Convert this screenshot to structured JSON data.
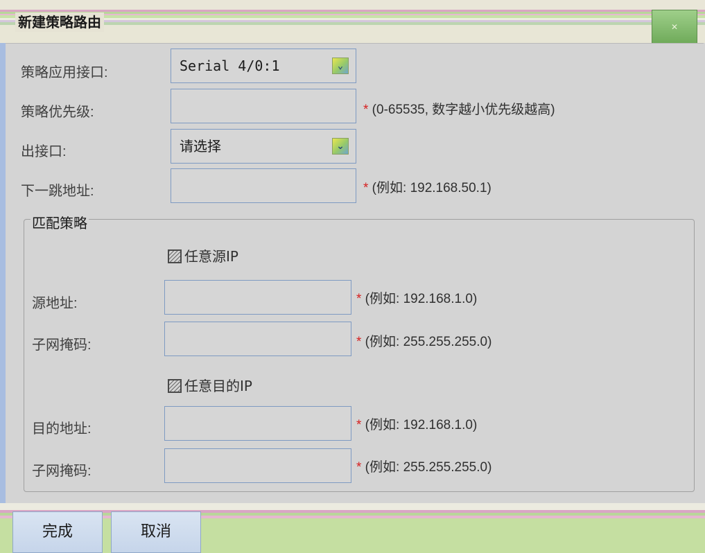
{
  "dialog": {
    "title": "新建策略路由",
    "close_label": "关闭"
  },
  "form": {
    "interface_label": "策略应用接口:",
    "interface_value": "Serial 4/0:1",
    "priority_label": "策略优先级:",
    "priority_value": "",
    "priority_hint_star": "*",
    "priority_hint": " (0-65535, 数字越小优先级越高)",
    "out_iface_label": "出接口:",
    "out_iface_value": "请选择",
    "nexthop_label": "下一跳地址:",
    "nexthop_value": "",
    "nexthop_hint_star": "*",
    "nexthop_hint": " (例如: 192.168.50.1)"
  },
  "match": {
    "legend": "匹配策略",
    "any_src_label": "任意源IP",
    "any_src_checked": true,
    "src_addr_label": "源地址:",
    "src_addr_value": "",
    "src_addr_hint_star": "*",
    "src_addr_hint": " (例如: 192.168.1.0)",
    "src_mask_label": "子网掩码:",
    "src_mask_value": "",
    "src_mask_hint_star": "*",
    "src_mask_hint": " (例如: 255.255.255.0)",
    "any_dst_label": "任意目的IP",
    "any_dst_checked": true,
    "dst_addr_label": "目的地址:",
    "dst_addr_value": "",
    "dst_addr_hint_star": "*",
    "dst_addr_hint": " (例如: 192.168.1.0)",
    "dst_mask_label": "子网掩码:",
    "dst_mask_value": "",
    "dst_mask_hint_star": "*",
    "dst_mask_hint": " (例如: 255.255.255.0)"
  },
  "footer": {
    "finish_label": "完成",
    "cancel_label": "取消"
  },
  "icons": {
    "dropdown": "chevron-down-icon",
    "close": "close-icon",
    "checkbox": "checkbox-icon"
  },
  "colors": {
    "required_star": "#d62020",
    "field_border": "#7e9ac2",
    "close_button": "#6faa59"
  }
}
